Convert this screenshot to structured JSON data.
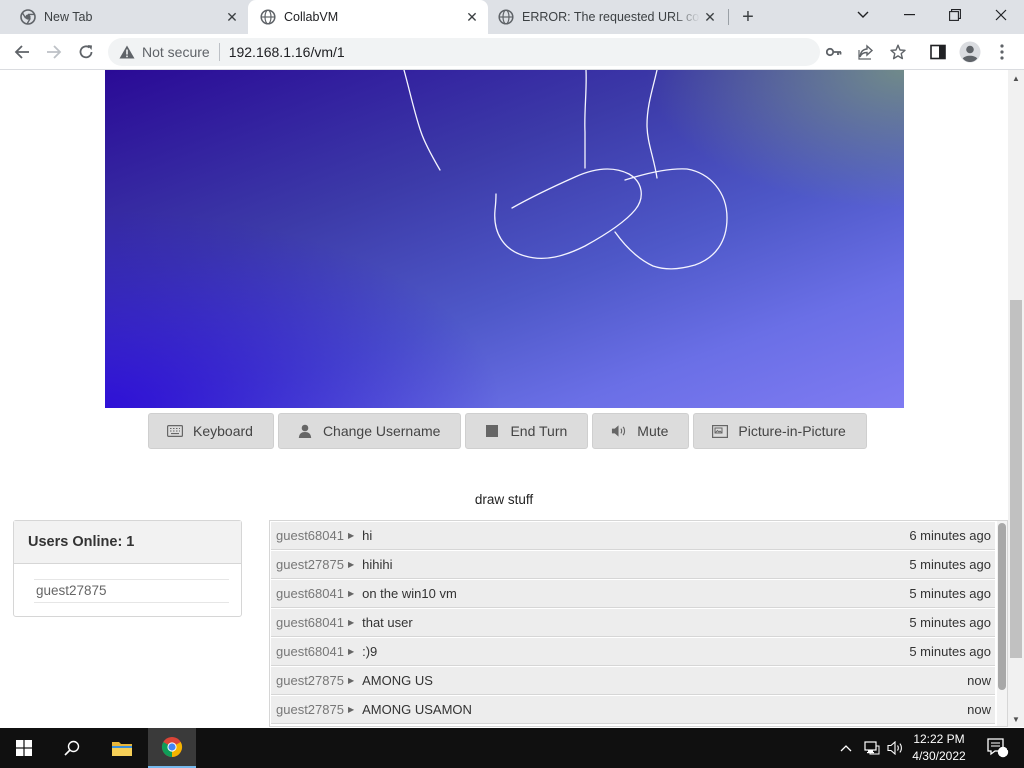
{
  "browser": {
    "tabs": [
      {
        "title": "New Tab",
        "active": false
      },
      {
        "title": "CollabVM",
        "active": true
      },
      {
        "title": "ERROR: The requested URL could not be retrieved",
        "active": false
      }
    ],
    "address": {
      "security_label": "Not secure",
      "url": "192.168.1.16/vm/1"
    }
  },
  "vm": {
    "buttons": [
      {
        "label": "Keyboard",
        "icon": "keyboard-icon"
      },
      {
        "label": "Change Username",
        "icon": "user-icon"
      },
      {
        "label": "End Turn",
        "icon": "stop-icon"
      },
      {
        "label": "Mute",
        "icon": "speaker-icon"
      },
      {
        "label": "Picture-in-Picture",
        "icon": "picture-in-picture-icon"
      }
    ],
    "title": "draw stuff"
  },
  "users": {
    "header_label": "Users Online:",
    "count": "1",
    "list": [
      "guest27875"
    ]
  },
  "chat": {
    "messages": [
      {
        "user": "guest68041",
        "text": "hi",
        "time": "6 minutes ago"
      },
      {
        "user": "guest27875",
        "text": "hihihi",
        "time": "5 minutes ago"
      },
      {
        "user": "guest68041",
        "text": "on the win10 vm",
        "time": "5 minutes ago"
      },
      {
        "user": "guest68041",
        "text": "that user",
        "time": "5 minutes ago"
      },
      {
        "user": "guest68041",
        "text": ":)9",
        "time": "5 minutes ago"
      },
      {
        "user": "guest27875",
        "text": "AMONG US",
        "time": "now"
      },
      {
        "user": "guest27875",
        "text": "AMONG USAMON",
        "time": "now"
      }
    ]
  },
  "taskbar": {
    "time": "12:22 PM",
    "date": "4/30/2022",
    "notification_count": "1"
  }
}
